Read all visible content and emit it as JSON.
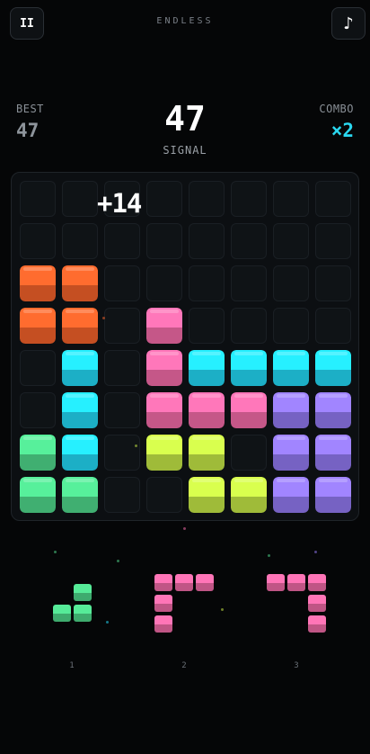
{
  "header": {
    "pause_label": "II",
    "pause_icon": "pause-icon",
    "mode_title": "ENDLESS",
    "music_label": "♪",
    "music_icon": "music-note-icon"
  },
  "stats": {
    "best_label": "BEST",
    "best_value": "47",
    "score_value": "47",
    "score_label": "SIGNAL",
    "combo_label": "COMBO",
    "combo_value": "×2"
  },
  "popup": {
    "text": "+14"
  },
  "colors": {
    "orange": "#f0602a",
    "pink": "#f06aa6",
    "cyan": "#22d6f2",
    "purple": "#9077ee",
    "lime": "#c2e446",
    "green": "#4ed68a",
    "accent": "#2ad8f0"
  },
  "board": {
    "rows": 8,
    "cols": 8,
    "grid": [
      [
        "",
        "",
        "",
        "",
        "",
        "",
        "",
        ""
      ],
      [
        "",
        "",
        "",
        "",
        "",
        "",
        "",
        ""
      ],
      [
        "orange",
        "orange",
        "",
        "",
        "",
        "",
        "",
        ""
      ],
      [
        "orange",
        "orange",
        "",
        "pink",
        "",
        "",
        "",
        ""
      ],
      [
        "",
        "cyan",
        "",
        "pink",
        "cyan",
        "cyan",
        "cyan",
        "cyan"
      ],
      [
        "",
        "cyan",
        "",
        "pink",
        "pink",
        "pink",
        "purple",
        "purple"
      ],
      [
        "green",
        "cyan",
        "",
        "lime",
        "lime",
        "",
        "purple",
        "purple"
      ],
      [
        "green",
        "green",
        "",
        "",
        "lime",
        "lime",
        "purple",
        "purple"
      ]
    ]
  },
  "tray": [
    {
      "label": "1",
      "color": "green",
      "cells": [
        [
          0,
          1
        ],
        [
          1,
          0
        ],
        [
          1,
          1
        ]
      ]
    },
    {
      "label": "2",
      "color": "pink",
      "cells": [
        [
          0,
          0
        ],
        [
          0,
          1
        ],
        [
          0,
          2
        ],
        [
          1,
          0
        ],
        [
          2,
          0
        ]
      ]
    },
    {
      "label": "3",
      "color": "pink",
      "cells": [
        [
          0,
          0
        ],
        [
          0,
          1
        ],
        [
          0,
          2
        ],
        [
          1,
          2
        ],
        [
          2,
          2
        ]
      ]
    }
  ]
}
